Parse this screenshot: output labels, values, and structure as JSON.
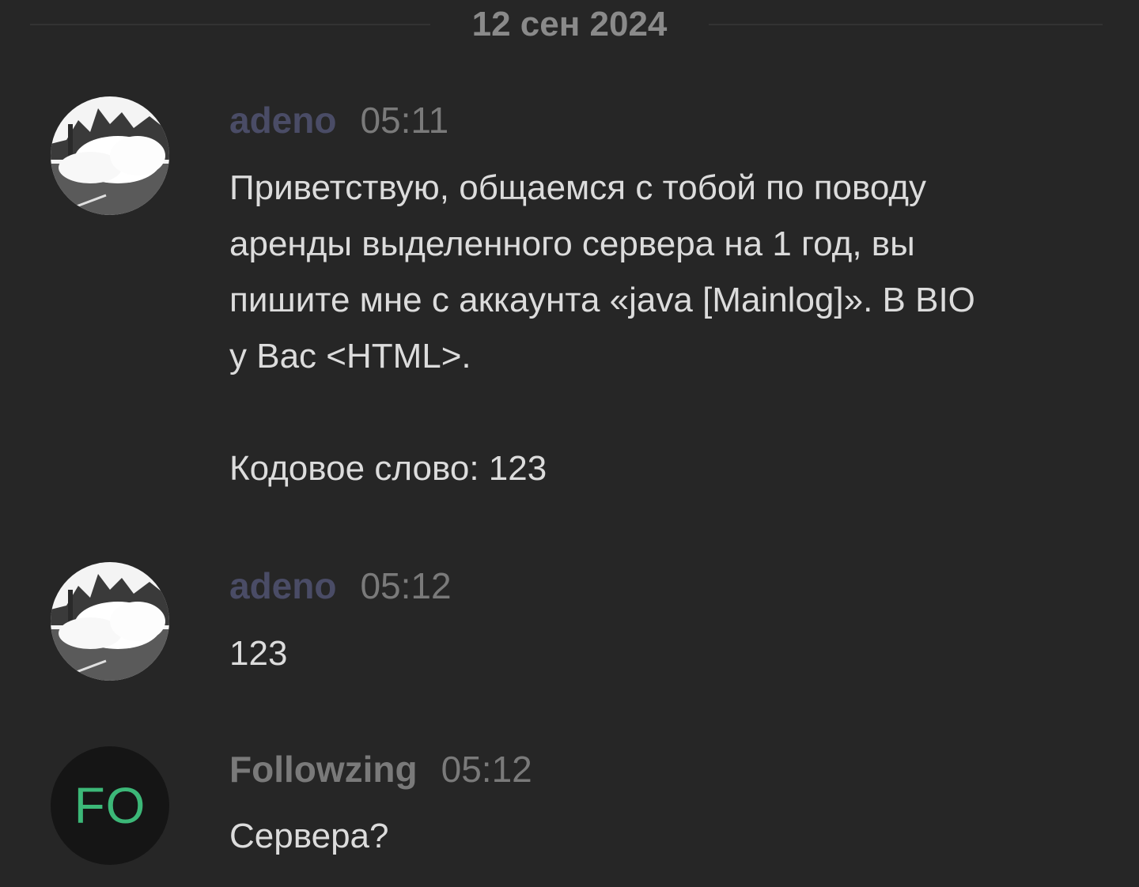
{
  "date_divider": "12 сен 2024",
  "messages": [
    {
      "username": "adeno",
      "time": "05:11",
      "lines": [
        "Приветствую, общаемся с тобой по поводу",
        "аренды выделенного сервера на 1 год, вы",
        "пишите мне с аккаунта «java [Mainlog]». В BIO",
        "у Вас <HTML>.",
        "Кодовое слово: 123"
      ]
    },
    {
      "username": "adeno",
      "time": "05:12",
      "text": "123"
    },
    {
      "username": "Followzing",
      "time": "05:12",
      "avatar_initials": "FO",
      "text": "Сервера?"
    }
  ],
  "colors": {
    "background": "#262626",
    "username_dim": "#4a4c66",
    "username": "#7a7a7a",
    "avatar_initials": "#3cb878"
  }
}
